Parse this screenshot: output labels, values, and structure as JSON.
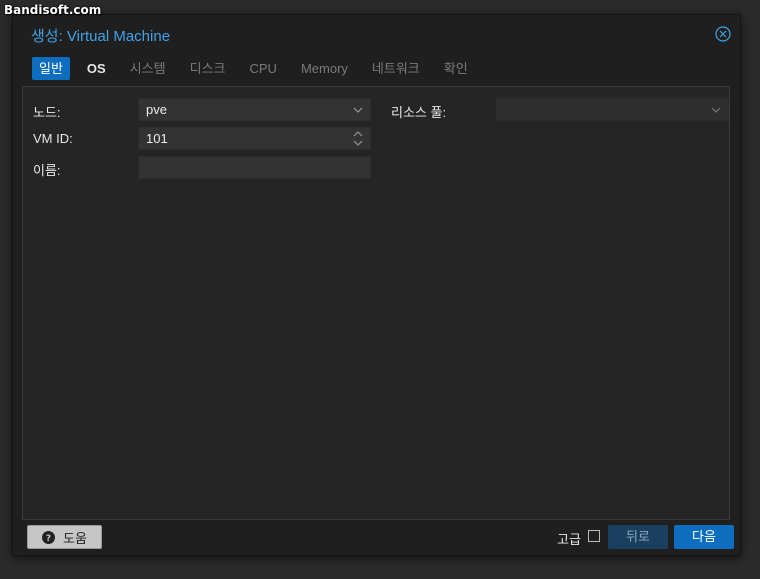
{
  "watermark": "Bandisoft.com",
  "dialog": {
    "title": "생성: Virtual Machine",
    "close_icon": "close-circle-icon"
  },
  "tabs": [
    {
      "label": "일반",
      "state": "active"
    },
    {
      "label": "OS",
      "state": "enabled"
    },
    {
      "label": "시스템",
      "state": "disabled"
    },
    {
      "label": "디스크",
      "state": "disabled"
    },
    {
      "label": "CPU",
      "state": "disabled"
    },
    {
      "label": "Memory",
      "state": "disabled"
    },
    {
      "label": "네트워크",
      "state": "disabled"
    },
    {
      "label": "확인",
      "state": "disabled"
    }
  ],
  "form": {
    "node": {
      "label": "노드:",
      "value": "pve"
    },
    "vmid": {
      "label": "VM ID:",
      "value": "101"
    },
    "name": {
      "label": "이름:",
      "value": ""
    },
    "pool": {
      "label": "리소스 풀:",
      "value": ""
    }
  },
  "footer": {
    "help_label": "도움",
    "advanced_label": "고급",
    "advanced_checked": false,
    "back_label": "뒤로",
    "next_label": "다음"
  },
  "colors": {
    "accent": "#0d6ebf",
    "title": "#3fa3e8",
    "background": "#1f1f1f"
  }
}
